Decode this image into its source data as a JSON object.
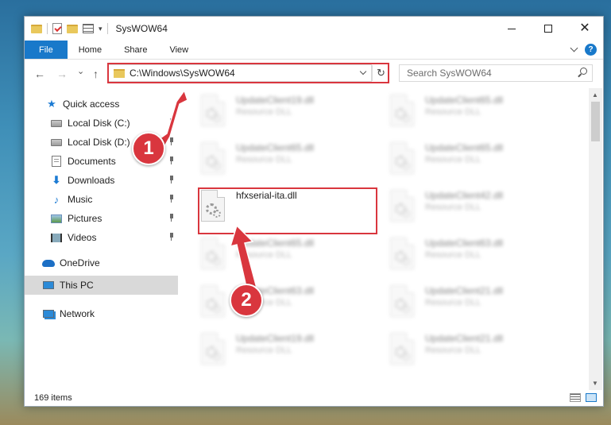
{
  "window": {
    "title": "SysWOW64",
    "minimize_glyph": "",
    "close_glyph": "✕"
  },
  "ribbon": {
    "tabs": [
      "File",
      "Home",
      "Share",
      "View"
    ],
    "help_glyph": "?"
  },
  "address": {
    "path": "C:\\Windows\\SysWOW64",
    "refresh_glyph": "↻",
    "back_glyph": "←",
    "forward_glyph": "→",
    "recent_glyph": "⌄",
    "up_glyph": "↑"
  },
  "search": {
    "placeholder": "Search SysWOW64"
  },
  "sidebar": {
    "items": [
      {
        "label": "Quick access",
        "icon": "star-icon",
        "pinned": false
      },
      {
        "label": "Local Disk (C:)",
        "icon": "drive-icon",
        "pinned": true
      },
      {
        "label": "Local Disk (D:)",
        "icon": "drive-icon",
        "pinned": true
      },
      {
        "label": "Documents",
        "icon": "documents-icon",
        "pinned": true
      },
      {
        "label": "Downloads",
        "icon": "downloads-icon",
        "pinned": true
      },
      {
        "label": "Music",
        "icon": "music-icon",
        "pinned": true
      },
      {
        "label": "Pictures",
        "icon": "pictures-icon",
        "pinned": true
      },
      {
        "label": "Videos",
        "icon": "videos-icon",
        "pinned": true
      },
      {
        "label": "OneDrive",
        "icon": "onedrive-icon",
        "pinned": false
      },
      {
        "label": "This PC",
        "icon": "this-pc-icon",
        "pinned": false,
        "selected": true
      },
      {
        "label": "Network",
        "icon": "network-icon",
        "pinned": false
      }
    ]
  },
  "files": {
    "highlighted": {
      "name": "hfxserial-ita.dll",
      "type": ""
    },
    "blurred_left": [
      {
        "name": "UpdateClient19.dll",
        "type": "Resource DLL"
      },
      {
        "name": "UpdateClient65.dll",
        "type": "Resource DLL"
      },
      {
        "name": "UpdateClient65.dll",
        "type": "Resource DLL"
      },
      {
        "name": "UpdateClient63.dll",
        "type": "Resource DLL"
      },
      {
        "name": "UpdateClient19.dll",
        "type": "Resource DLL"
      }
    ],
    "blurred_right": [
      {
        "name": "UpdateClient65.dll",
        "type": "Resource DLL"
      },
      {
        "name": "UpdateClient65.dll",
        "type": "Resource DLL"
      },
      {
        "name": "UpdateClient42.dll",
        "type": "Resource DLL"
      },
      {
        "name": "UpdateClient63.dll",
        "type": "Resource DLL"
      },
      {
        "name": "UpdateClient21.dll",
        "type": "Resource DLL"
      },
      {
        "name": "UpdateClient21.dll",
        "type": "Resource DLL"
      }
    ]
  },
  "status": {
    "item_count": "169 items"
  },
  "callouts": {
    "step1": "1",
    "step2": "2"
  },
  "colors": {
    "accent": "#1979ca",
    "highlight": "#d9363e"
  }
}
